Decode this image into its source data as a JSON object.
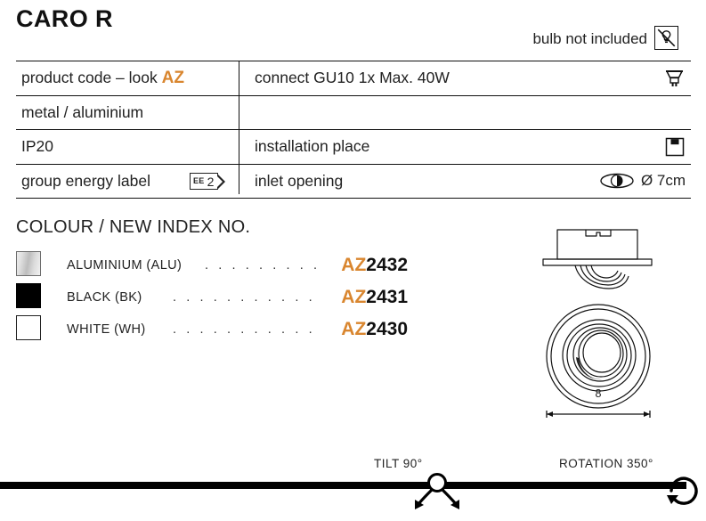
{
  "header": {
    "title": "CARO R",
    "bulb_note": "bulb not included",
    "nobulb_icon": "no-bulb-icon"
  },
  "spec_table": {
    "rows": [
      {
        "left": "product code – look ",
        "left_accent": "AZ",
        "right": "connect GU10 1x Max. 40W",
        "right_icon": "gu10-bulb-icon"
      },
      {
        "left": "metal / aluminium",
        "right": "",
        "right_icon": ""
      },
      {
        "left": "IP20",
        "right": "installation place",
        "right_icon": "ceiling-mount-icon"
      },
      {
        "left": "group energy label",
        "left_badge": {
          "prefix": "EE",
          "value": "2"
        },
        "right": "inlet opening",
        "right_icon": "inlet-opening-icon",
        "right_value": "Ø 7cm"
      }
    ]
  },
  "colour_section": {
    "heading": "COLOUR / NEW INDEX NO.",
    "items": [
      {
        "name": "ALUMINIUM (ALU)",
        "swatch": "#c9c9c9",
        "swatch_type": "gradient",
        "code_prefix": "AZ",
        "code_number": "2432",
        "leader": ". . . . . . . . . ."
      },
      {
        "name": "BLACK (BK)",
        "swatch": "#000000",
        "swatch_type": "solid",
        "code_prefix": "AZ",
        "code_number": "2431",
        "leader": ". . . . . . . . . . . . ."
      },
      {
        "name": "WHITE (WH)",
        "swatch": "#ffffff",
        "swatch_type": "solid",
        "code_prefix": "AZ",
        "code_number": "2430",
        "leader": ". . . . . . . . . . . . ."
      }
    ]
  },
  "drawing": {
    "name": "recessed-downlight-drawing",
    "dimension_label": "8"
  },
  "bottom_bar": {
    "tilt_label": "TILT 90°",
    "rotation_label": "ROTATION 350°",
    "tilt_icon": "tilt-arrows-icon",
    "rotation_icon": "rotation-arrow-icon"
  },
  "colors": {
    "accent_orange": "#D9862F",
    "ink": "#111111"
  }
}
